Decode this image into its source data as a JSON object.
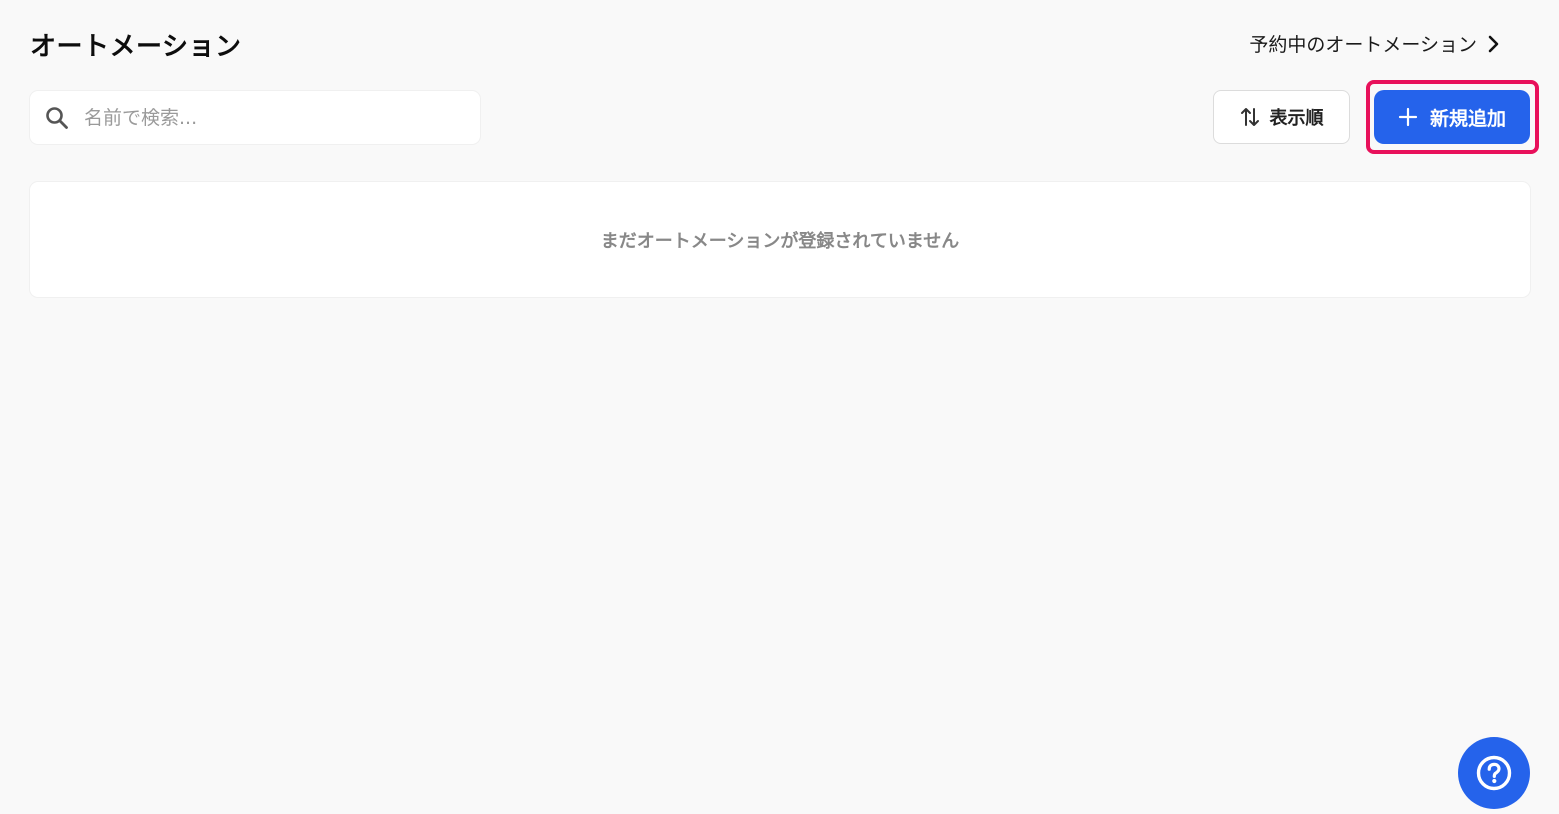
{
  "header": {
    "title": "オートメーション",
    "scheduled_link_label": "予約中のオートメーション"
  },
  "search": {
    "placeholder": "名前で検索...",
    "value": ""
  },
  "toolbar": {
    "sort_label": "表示順",
    "add_label": "新規追加"
  },
  "empty_state": {
    "message": "まだオートメーションが登録されていません"
  },
  "icons": {
    "search": "search-icon",
    "sort": "sort-arrows-icon",
    "add": "plus-icon",
    "link_arrow": "chevron-right-icon",
    "help": "question-circle-icon"
  },
  "colors": {
    "accent": "#2563eb",
    "highlight": "#e8115b",
    "background": "#f9f9f9",
    "muted_text": "#888888"
  }
}
